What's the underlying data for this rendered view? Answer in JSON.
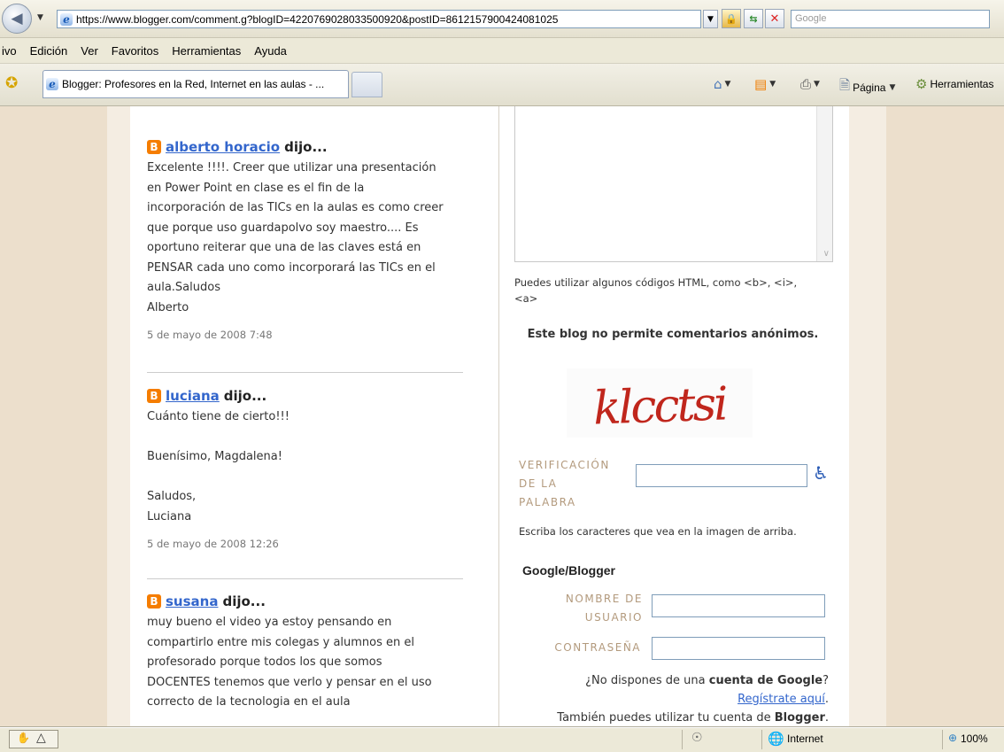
{
  "browser": {
    "url": "https://www.blogger.com/comment.g?blogID=4220769028033500920&postID=8612157900424081025",
    "search_placeholder": "Google",
    "menu": [
      "ivo",
      "Edición",
      "Ver",
      "Favoritos",
      "Herramientas",
      "Ayuda"
    ],
    "tab_title": "Blogger: Profesores en la Red, Internet en las aulas - ...",
    "cmd_page": "Página",
    "cmd_tools": "Herramientas",
    "status_zone": "Internet",
    "status_zoom": "100%"
  },
  "comments": [
    {
      "author": "alberto horacio",
      "suffix": "dijo...",
      "body": "Excelente !!!!. Creer que utilizar una presentación\nen Power Point en clase es el fin de la\nincorporación de las TICs en la aulas es como creer\nque porque uso guardapolvo soy maestro.... Es\noportuno reiterar que una de las claves está en\nPENSAR cada uno como incorporará las TICs en el\naula.Saludos\nAlberto",
      "time": "5 de mayo de 2008 7:48"
    },
    {
      "author": "luciana",
      "suffix": "dijo...",
      "body": "Cuánto tiene de cierto!!!\n\nBuenísimo, Magdalena!\n\nSaludos,\nLuciana",
      "time": "5 de mayo de 2008 12:26"
    },
    {
      "author": "susana",
      "suffix": "dijo...",
      "body": "muy bueno el video ya estoy pensando en\ncompartirlo entre mis colegas y alumnos en el\nprofesorado porque todos los que somos\nDOCENTES tenemos que verlo y pensar en el uso\ncorrecto de la tecnologia en el aula",
      "time": ""
    }
  ],
  "form": {
    "html_hint_1": "Puedes utilizar algunos códigos HTML, como <b>, <i>,",
    "html_hint_2": "<a>",
    "anon_notice": "Este blog no permite comentarios anónimos.",
    "captcha_word": "klcctsi",
    "verif_label_1": "VERIFICACIÓN",
    "verif_label_2": "DE LA",
    "verif_label_3": "PALABRA",
    "verif_hint": "Escriba los caracteres que vea en la imagen de arriba.",
    "account_heading": "Google/Blogger",
    "username_label_1": "NOMBRE DE",
    "username_label_2": "USUARIO",
    "password_label": "CONTRASEÑA",
    "no_account_1": "¿No dispones de una",
    "no_account_2": "cuenta de Google",
    "no_account_3": "?",
    "register_link": "Regístrate aquí",
    "register_period": ".",
    "blogger_account_1": "También puedes utilizar tu cuenta de",
    "blogger_account_2": "Blogger",
    "blogger_account_3": "."
  },
  "colors": {
    "link": "#3366cc",
    "blogger_orange": "#f57d00",
    "label_tan": "#b39a7d",
    "page_bg": "#ecdfcc"
  }
}
